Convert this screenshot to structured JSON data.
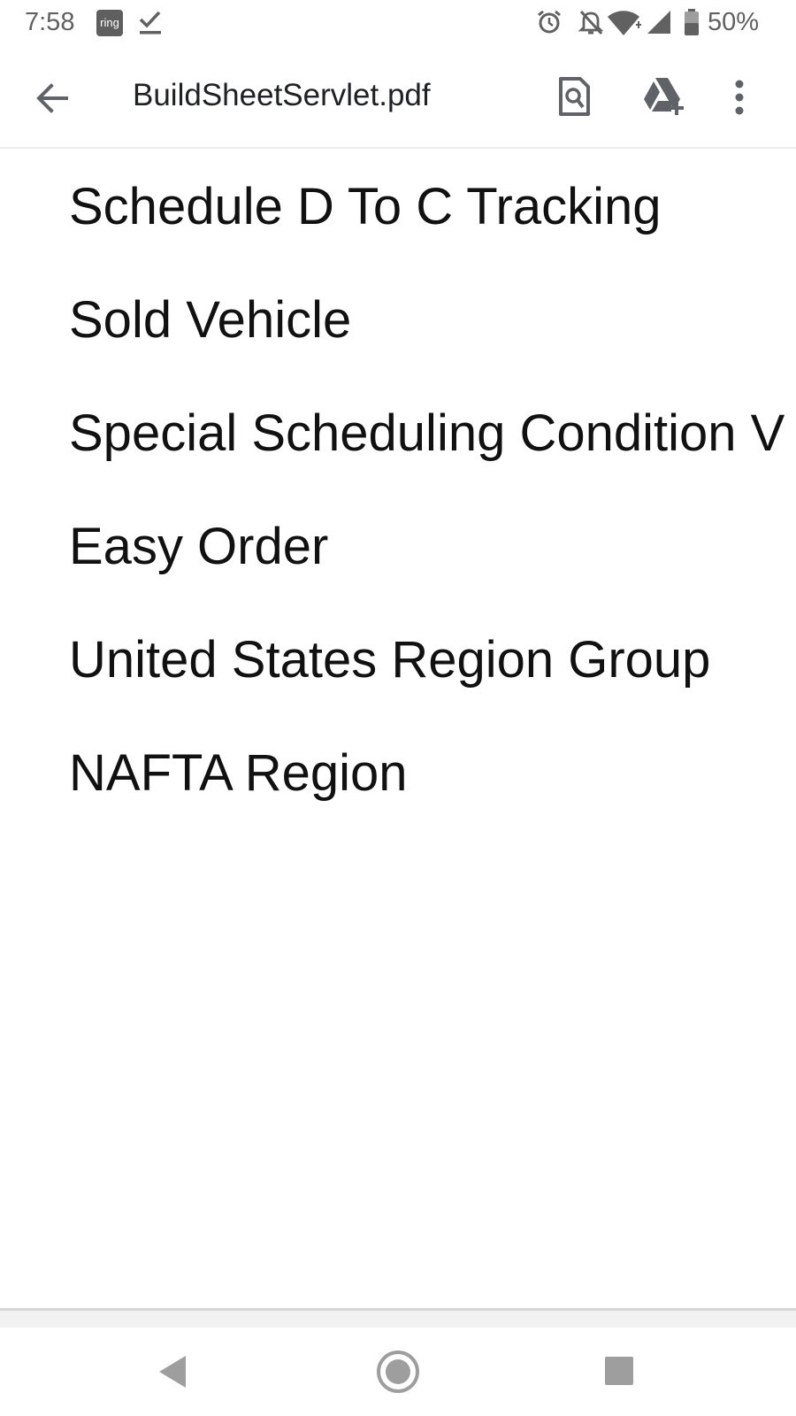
{
  "status_bar": {
    "time": "7:58",
    "notification_app": "ring",
    "battery": "50%",
    "icons": [
      "ring-icon",
      "check-icon",
      "alarm-icon",
      "bell-off-icon",
      "wifi-icon",
      "signal-icon",
      "battery-icon"
    ]
  },
  "app_bar": {
    "title": "BuildSheetServlet.pdf",
    "icons": [
      "back-arrow-icon",
      "find-in-page-icon",
      "drive-add-icon",
      "more-vert-icon"
    ]
  },
  "document": {
    "lines": [
      "Schedule D To C Tracking",
      "Sold Vehicle",
      "Special Scheduling Condition V",
      "Easy Order",
      "United States Region Group",
      "NAFTA Region"
    ]
  },
  "nav_bar": {
    "icons": [
      "nav-back-icon",
      "nav-home-icon",
      "nav-recents-icon"
    ]
  },
  "colors": {
    "status_icon": "#616161",
    "toolbar_icon": "#5f6368",
    "text": "#111111",
    "nav_icon": "#9e9e9e"
  }
}
